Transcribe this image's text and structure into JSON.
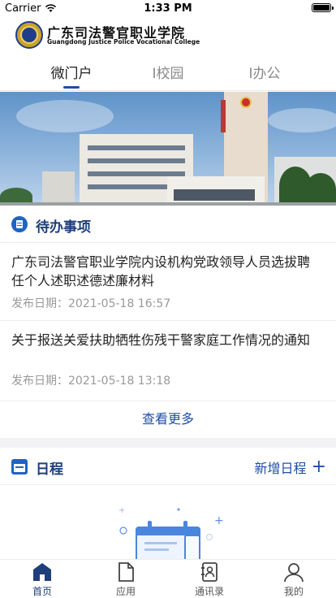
{
  "status_bar": {
    "carrier": "Carrier",
    "time": "1:33 PM"
  },
  "header": {
    "college_name_cn": "广东司法警官职业学院",
    "college_name_en": "Guangdong Justice Police Vocational College"
  },
  "tabs": [
    {
      "label": "微门户",
      "active": true
    },
    {
      "label": "I校园",
      "active": false
    },
    {
      "label": "I办公",
      "active": false
    }
  ],
  "todo": {
    "title": "待办事项",
    "items": [
      {
        "title": "广东司法警官职业学院内设机构党政领导人员选拔聘任个人述职述德述廉材料",
        "date": "发布日期：2021-05-18 16:57"
      },
      {
        "title": "关于报送关爱扶助牺牲伤残干警家庭工作情况的通知",
        "date": "发布日期：2021-05-18 13:18"
      }
    ],
    "more_label": "查看更多"
  },
  "schedule": {
    "title": "日程",
    "add_label": "新增日程"
  },
  "tabbar": [
    {
      "label": "首页",
      "icon": "home-icon",
      "active": true
    },
    {
      "label": "应用",
      "icon": "document-icon",
      "active": false
    },
    {
      "label": "通讯录",
      "icon": "contacts-icon",
      "active": false
    },
    {
      "label": "我的",
      "icon": "profile-icon",
      "active": false
    }
  ],
  "colors": {
    "accent": "#1e4fa3",
    "section_title": "#1e3f7a",
    "icon_blue": "#1e63c5"
  }
}
